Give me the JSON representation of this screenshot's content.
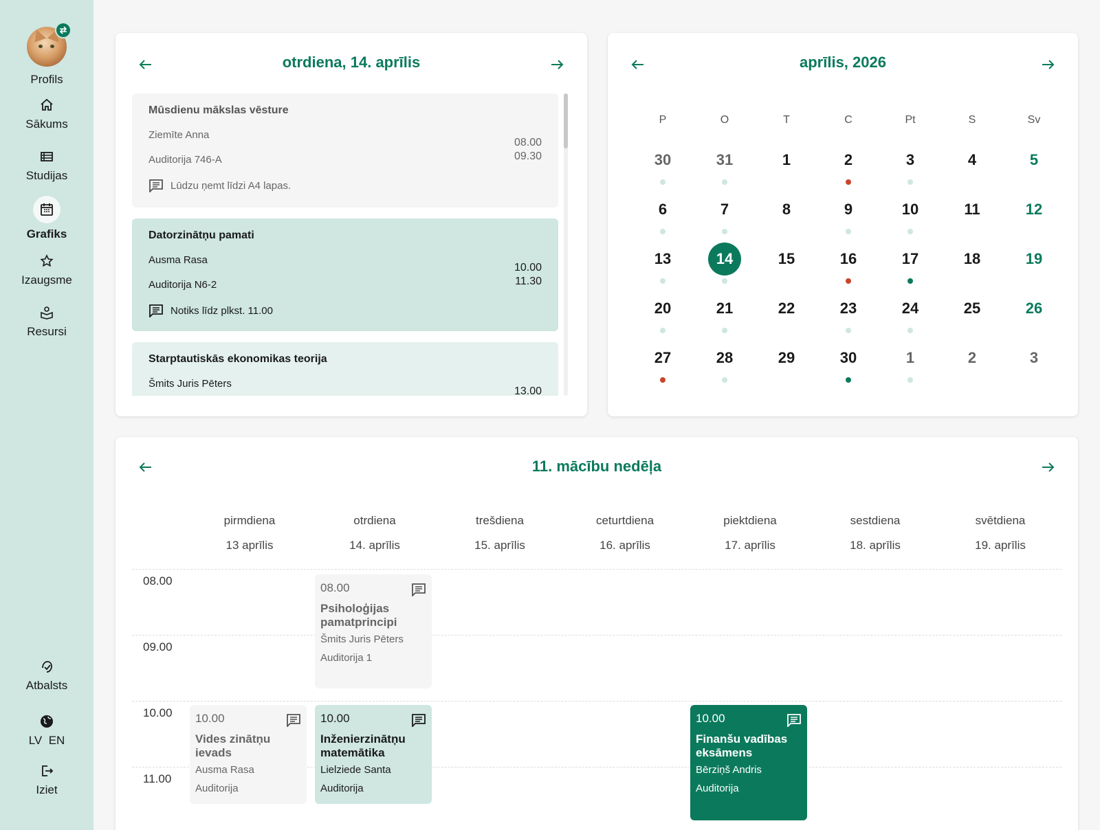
{
  "sidebar": {
    "profile_label": "Profils",
    "items": [
      {
        "label": "Sākums",
        "icon": "home-icon"
      },
      {
        "label": "Studijas",
        "icon": "list-icon"
      },
      {
        "label": "Grafiks",
        "icon": "calendar-icon",
        "active": true
      },
      {
        "label": "Izaugsme",
        "icon": "star-icon"
      },
      {
        "label": "Resursi",
        "icon": "book-icon"
      }
    ],
    "support_label": "Atbalsts",
    "lang_lv": "LV",
    "lang_en": "EN",
    "logout_label": "Iziet"
  },
  "day": {
    "title": "otrdiena, 14. aprīlis",
    "events": [
      {
        "name": "Mūsdienu mākslas vēsture",
        "teacher": "Ziemīte Anna",
        "room": "Auditorija 746-A",
        "start": "08.00",
        "end": "09.30",
        "note": "Lūdzu ņemt līdzi A4 lapas."
      },
      {
        "name": "Datorzinātņu pamati",
        "teacher": "Ausma Rasa",
        "room": "Auditorija N6-2",
        "start": "10.00",
        "end": "11.30",
        "note": "Notiks līdz plkst. 11.00"
      },
      {
        "name": "Starptautiskās ekonomikas teorija",
        "teacher": "Šmits Juris Pēters",
        "start": "13.00"
      }
    ]
  },
  "month": {
    "title": "aprīlis, 2026",
    "weekdays": [
      "P",
      "O",
      "T",
      "C",
      "Pt",
      "S",
      "Sv"
    ],
    "weeks": [
      [
        "30",
        "31",
        "1",
        "2",
        "3",
        "4",
        "5"
      ],
      [
        "6",
        "7",
        "8",
        "9",
        "10",
        "11",
        "12"
      ],
      [
        "13",
        "14",
        "15",
        "16",
        "17",
        "18",
        "19"
      ],
      [
        "20",
        "21",
        "22",
        "23",
        "24",
        "25",
        "26"
      ],
      [
        "27",
        "28",
        "29",
        "30",
        "1",
        "2",
        "3"
      ]
    ],
    "selected": "14",
    "colors": {
      "accent": "#0b7a5c",
      "dot_light": "#cfe6e1",
      "dot_red": "#c8452b",
      "dot_green": "#0b7a5c"
    }
  },
  "week": {
    "title": "11. mācību nedēļa",
    "days": [
      {
        "name": "pirmdiena",
        "date": "13 aprīlis"
      },
      {
        "name": "otrdiena",
        "date": "14. aprīlis"
      },
      {
        "name": "trešdiena",
        "date": "15. aprīlis"
      },
      {
        "name": "ceturtdiena",
        "date": "16. aprīlis"
      },
      {
        "name": "piektdiena",
        "date": "17. aprīlis"
      },
      {
        "name": "sestdiena",
        "date": "18. aprīlis"
      },
      {
        "name": "svētdiena",
        "date": "19. aprīlis"
      }
    ],
    "hours": [
      "08.00",
      "09.00",
      "10.00",
      "11.00"
    ],
    "events": [
      {
        "time": "08.00",
        "name": "Psiholoģijas pamatprincipi",
        "teacher": "Šmits Juris Pēters",
        "room": "Auditorija 1"
      },
      {
        "time": "10.00",
        "name": "Vides zinātņu ievads",
        "teacher": "Ausma Rasa",
        "room": "Auditorija"
      },
      {
        "time": "10.00",
        "name": "Inženierzinātņu matemātika",
        "teacher": "Lielziede Santa",
        "room": "Auditorija"
      },
      {
        "time": "10.00",
        "name": "Finanšu vadības eksāmens",
        "teacher": "Bērziņš Andris",
        "room": "Auditorija"
      }
    ]
  }
}
